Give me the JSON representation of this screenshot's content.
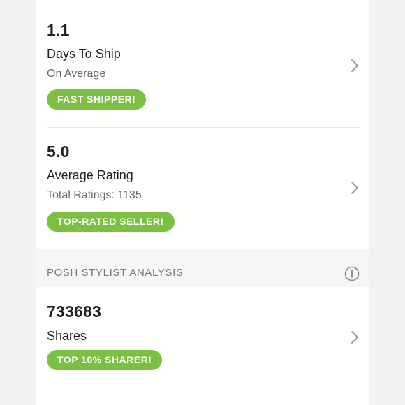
{
  "stats": [
    {
      "value": "1.1",
      "label": "Days To Ship",
      "sub": "On Average",
      "badge": "FAST SHIPPER!"
    },
    {
      "value": "5.0",
      "label": "Average Rating",
      "sub": "Total Ratings: 1135",
      "badge": "TOP-RATED SELLER!"
    }
  ],
  "section": {
    "title": "POSH STYLIST ANALYSIS"
  },
  "shares": {
    "value": "733683",
    "label": "Shares",
    "badge": "TOP 10% SHARER!"
  },
  "colors": {
    "badge": "#7bc043",
    "page_background": "#f2f2f2",
    "panel": "#ffffff"
  },
  "icons": {
    "row_arrow": "chevron-right-icon",
    "section_info": "info-icon"
  }
}
